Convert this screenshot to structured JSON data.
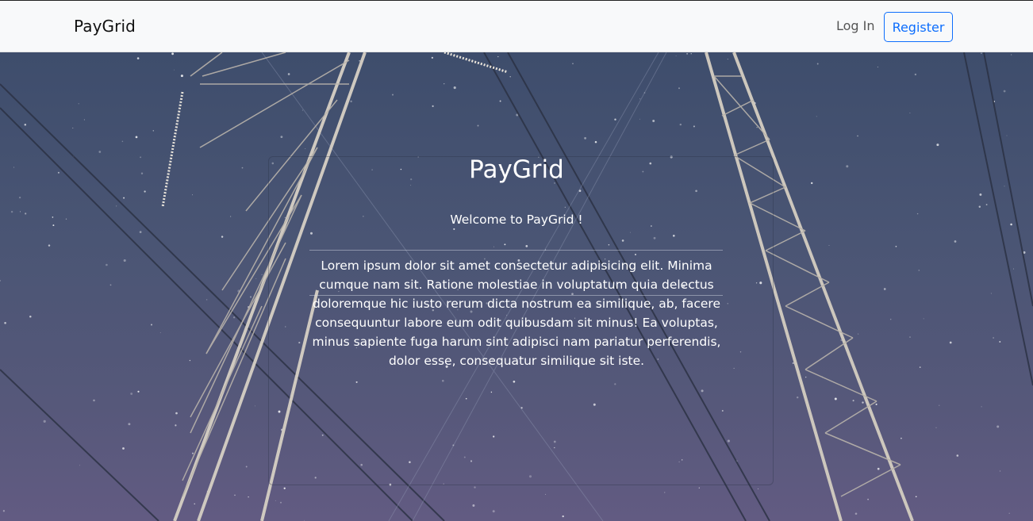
{
  "navbar": {
    "brand": "PayGrid",
    "login_label": "Log In",
    "register_label": "Register"
  },
  "hero": {
    "background_icon": "power-pylons-night-sky-image",
    "title": "PayGrid",
    "welcome": "Welcome to PayGrid !",
    "description": "Lorem ipsum dolor sit amet consectetur adipisicing elit. Minima cumque nam sit. Ratione molestiae in voluptatum quia delectus doloremque hic iusto rerum dicta nostrum ea similique, ab, facere consequuntur labore eum odit quibusdam sit minus! Ea voluptas, minus sapiente fuga harum sint adipisci nam pariatur perferendis, dolor esse, consequatur similique sit iste."
  },
  "colors": {
    "accent": "#0d6efd",
    "navbar_bg": "#f8f9fa",
    "sky_top": "#3e4d6c",
    "sky_bottom": "#625b82"
  }
}
